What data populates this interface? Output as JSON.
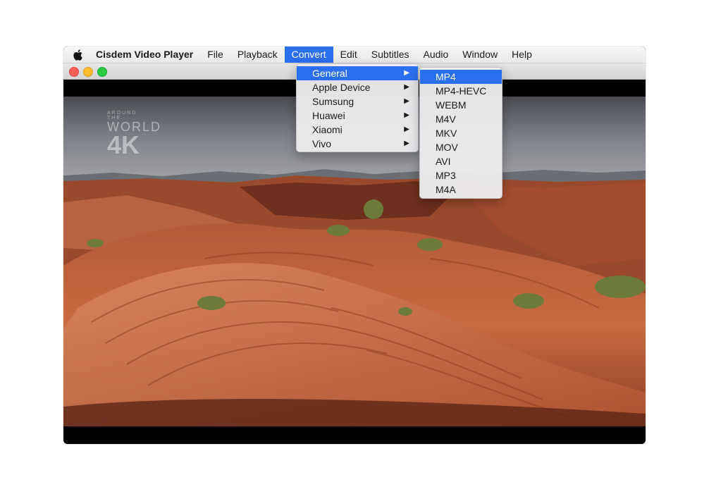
{
  "menubar": {
    "app_name": "Cisdem Video Player",
    "items": [
      "File",
      "Playback",
      "Convert",
      "Edit",
      "Subtitles",
      "Audio",
      "Window",
      "Help"
    ],
    "active": "Convert"
  },
  "convert_menu": {
    "items": [
      "General",
      "Apple Device",
      "Sumsung",
      "Huawei",
      "Xiaomi",
      "Vivo"
    ],
    "selected": "General"
  },
  "general_submenu": {
    "items": [
      "MP4",
      "MP4-HEVC",
      "WEBM",
      "M4V",
      "MKV",
      "MOV",
      "AVI",
      "MP3",
      "M4A"
    ],
    "selected": "MP4"
  },
  "video": {
    "watermark_top": "AROUND THE",
    "watermark_mid": "WORLD",
    "watermark_big": "4K"
  },
  "colors": {
    "accent": "#2a6ff0",
    "close": "#fc5f57",
    "minimize": "#fdbc2e",
    "zoom": "#29c940"
  }
}
